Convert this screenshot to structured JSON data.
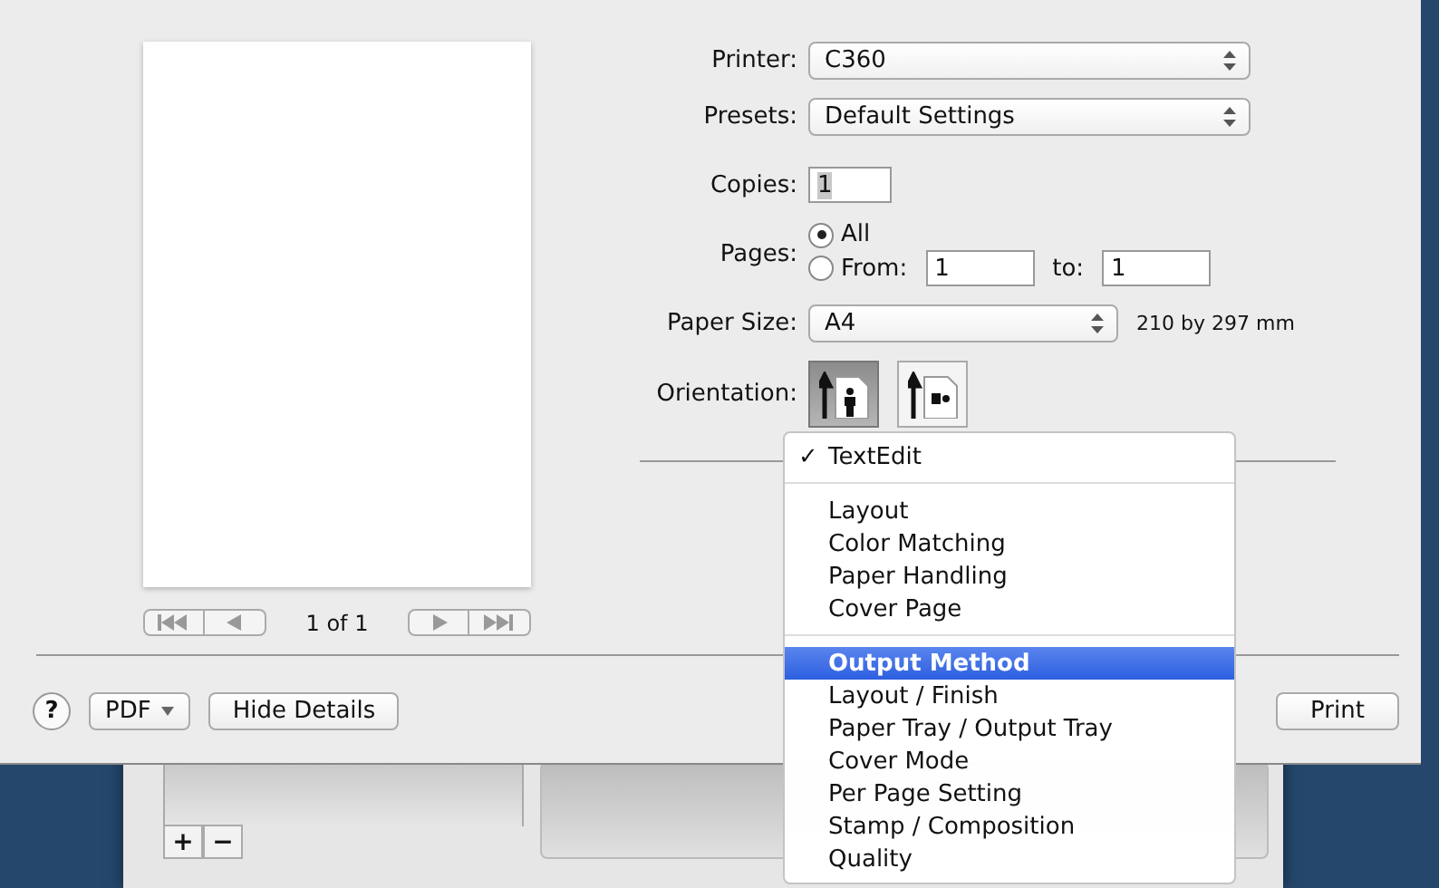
{
  "preview": {
    "page_counter": "1 of 1"
  },
  "form": [
    {
      "kind": "popup",
      "label": "Printer:",
      "value": "C360"
    },
    {
      "kind": "popup",
      "label": "Presets:",
      "value": "Default Settings"
    },
    {
      "kind": "number",
      "label": "Copies:",
      "value": "1"
    }
  ],
  "pages": {
    "label": "Pages:",
    "options": [
      {
        "label": "All",
        "selected": true
      },
      {
        "label": "From:",
        "selected": false
      }
    ],
    "from": "1",
    "to_label": "to:",
    "to": "1"
  },
  "paper_size": {
    "label": "Paper Size:",
    "value": "A4",
    "dimensions": "210 by 297 mm"
  },
  "orientation": {
    "label": "Orientation:",
    "options": [
      {
        "kind": "portrait",
        "selected": true
      },
      {
        "kind": "landscape",
        "selected": false
      }
    ]
  },
  "panel_menu": {
    "check_glyph": "✓",
    "groups": [
      {
        "items": [
          {
            "label": "TextEdit",
            "checked": true,
            "selected": false
          }
        ]
      },
      {
        "items": [
          {
            "label": "Layout",
            "checked": false,
            "selected": false
          },
          {
            "label": "Color Matching",
            "checked": false,
            "selected": false
          },
          {
            "label": "Paper Handling",
            "checked": false,
            "selected": false
          },
          {
            "label": "Cover Page",
            "checked": false,
            "selected": false
          }
        ]
      },
      {
        "items": [
          {
            "label": "Output Method",
            "checked": false,
            "selected": true
          },
          {
            "label": "Layout / Finish",
            "checked": false,
            "selected": false
          },
          {
            "label": "Paper Tray / Output Tray",
            "checked": false,
            "selected": false
          },
          {
            "label": "Cover Mode",
            "checked": false,
            "selected": false
          },
          {
            "label": "Per Page Setting",
            "checked": false,
            "selected": false
          },
          {
            "label": "Stamp / Composition",
            "checked": false,
            "selected": false
          },
          {
            "label": "Quality",
            "checked": false,
            "selected": false
          }
        ]
      }
    ]
  },
  "bottom_bar": {
    "help": "?",
    "pdf": "PDF",
    "hide_details": "Hide Details",
    "print": "Print"
  },
  "background_window": {
    "add": "+",
    "remove": "−"
  }
}
